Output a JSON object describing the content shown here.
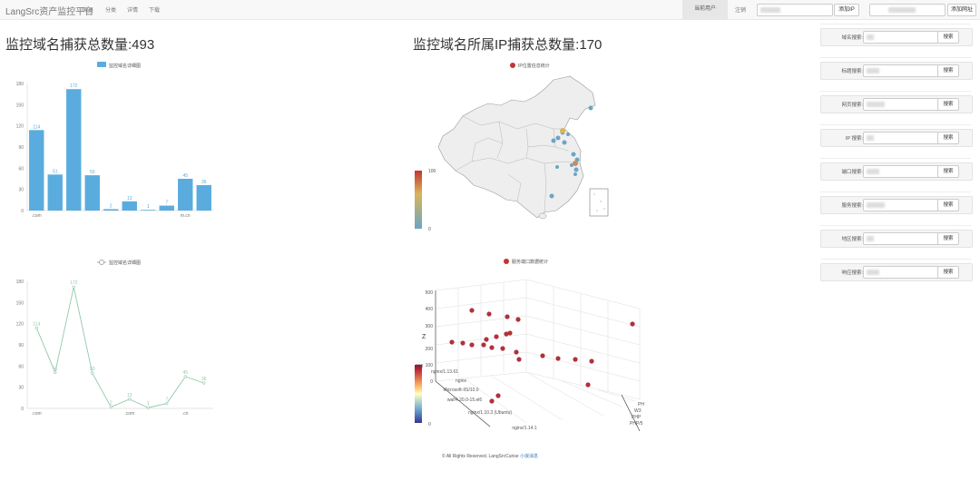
{
  "nav": {
    "brand": "LangSrc资产监控平台",
    "links": [
      "首页",
      "分类",
      "详情",
      "下载"
    ],
    "active_user": "当前用户",
    "logout": "注销",
    "add_ip": "添加IP",
    "add_url": "添加网址"
  },
  "domain_count": {
    "label": "监控域名捕获总数量:493"
  },
  "ip_count": {
    "label": "监控域名所属IP捕获总数量:170"
  },
  "bar_chart_data": {
    "type": "bar",
    "legend": "监控域名详细图",
    "ylim": [
      0,
      180
    ],
    "yticks": [
      "0",
      "30",
      "60",
      "90",
      "120",
      "150",
      "180"
    ],
    "x_visible_labels": [
      ".com",
      "",
      "",
      "",
      "",
      "",
      "",
      "",
      "m.cn",
      ""
    ],
    "values": [
      114,
      51,
      172,
      50,
      2,
      13,
      1,
      7,
      45,
      36
    ],
    "color": "#5aacde"
  },
  "line_chart_data": {
    "type": "line",
    "legend": "监控域名详细图",
    "ylim": [
      0,
      180
    ],
    "yticks": [
      "0",
      "30",
      "60",
      "90",
      "120",
      "150",
      "180"
    ],
    "x_visible_labels": [
      ".com",
      "",
      "",
      "",
      "",
      ".com",
      "",
      "",
      ".cn",
      ""
    ],
    "values": [
      114,
      51,
      172,
      50,
      2,
      13,
      1,
      7,
      45,
      36
    ],
    "color": "#93c9a8"
  },
  "map_chart": {
    "legend": "IP位置信息统计",
    "scale_max": "100",
    "scale_min": "0"
  },
  "scatter3d": {
    "legend": "服务端口数据统计",
    "scale_max": "100",
    "scale_min": "0",
    "z_axis": "Z",
    "z_ticks": [
      "0",
      "100",
      "200",
      "300",
      "400",
      "500"
    ],
    "y_labels": [
      "nginx/1.13.61",
      "nginx",
      "Microsoft-IIS/10.0",
      "waf/4.20.0-15.el6",
      "nginx/1.10.3 (Ubuntu)",
      "nginx/1.14.1"
    ],
    "x_labels": [
      "PH",
      "W3",
      "PHP",
      "PHP/5"
    ]
  },
  "sidebar": [
    {
      "label": "域名搜索:",
      "button": "搜索"
    },
    {
      "label": "标题搜索:",
      "button": "搜索"
    },
    {
      "label": "网页搜索:",
      "button": "搜索"
    },
    {
      "label": "IP 搜索:",
      "button": "搜索"
    },
    {
      "label": "端口搜索:",
      "button": "搜索"
    },
    {
      "label": "服务搜索:",
      "button": "搜索"
    },
    {
      "label": "地区搜索:",
      "button": "搜索"
    },
    {
      "label": "响应搜索:",
      "button": "搜索"
    }
  ],
  "footer": {
    "text": "© All Rights Reserved. LangSrcCurise ",
    "link": "小浪消息"
  }
}
